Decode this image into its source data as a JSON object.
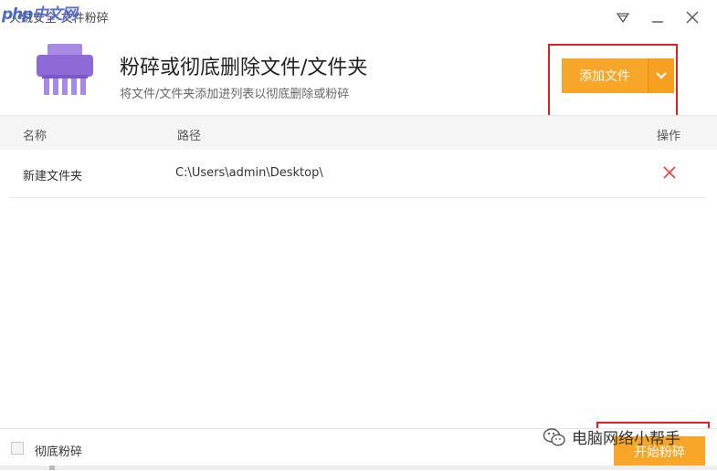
{
  "window": {
    "title": "火绒安全-文件粉碎",
    "watermark_php": "php",
    "watermark_cn": "中文网"
  },
  "header": {
    "title": "粉碎或彻底删除文件/文件夹",
    "subtitle": "将文件/文件夹添加进列表以彻底删除或粉碎",
    "add_button": "添加文件"
  },
  "table": {
    "columns": [
      "名称",
      "路径",
      "操作"
    ],
    "rows": [
      {
        "name": "新建文件夹",
        "path": "C:\\Users\\admin\\Desktop\\"
      }
    ]
  },
  "footer": {
    "checkbox_label": "彻底粉碎",
    "start_button": "开始粉碎",
    "watermark": "电脑网络小帮手"
  },
  "colors": {
    "accent": "#f7a628",
    "delete": "#e0443a",
    "icon_purple": "#8e6ad6",
    "highlight": "#e02020"
  }
}
